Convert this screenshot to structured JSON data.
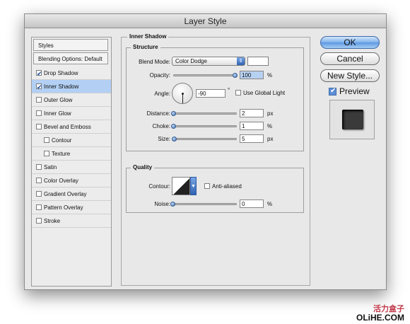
{
  "window": {
    "title": "Layer Style"
  },
  "sidebar": {
    "items": [
      {
        "label": "Styles",
        "kind": "head"
      },
      {
        "label": "Blending Options: Default",
        "kind": "plain"
      },
      {
        "label": "Drop Shadow",
        "kind": "check",
        "checked": true
      },
      {
        "label": "Inner Shadow",
        "kind": "check",
        "checked": true,
        "selected": true
      },
      {
        "label": "Outer Glow",
        "kind": "check",
        "checked": false
      },
      {
        "label": "Inner Glow",
        "kind": "check",
        "checked": false
      },
      {
        "label": "Bevel and Emboss",
        "kind": "check",
        "checked": false
      },
      {
        "label": "Contour",
        "kind": "check",
        "checked": false,
        "indent": true
      },
      {
        "label": "Texture",
        "kind": "check",
        "checked": false,
        "indent": true
      },
      {
        "label": "Satin",
        "kind": "check",
        "checked": false
      },
      {
        "label": "Color Overlay",
        "kind": "check",
        "checked": false
      },
      {
        "label": "Gradient Overlay",
        "kind": "check",
        "checked": false
      },
      {
        "label": "Pattern Overlay",
        "kind": "check",
        "checked": false
      },
      {
        "label": "Stroke",
        "kind": "check",
        "checked": false
      }
    ]
  },
  "panel": {
    "title": "Inner Shadow",
    "structure": {
      "title": "Structure",
      "blend_mode_label": "Blend Mode:",
      "blend_mode_value": "Color Dodge",
      "blend_color": "#ffffff",
      "opacity_label": "Opacity:",
      "opacity_value": "100",
      "opacity_unit": "%",
      "angle_label": "Angle:",
      "angle_value": "-90",
      "angle_unit": "°",
      "global_light_label": "Use Global Light",
      "global_light_checked": false,
      "distance_label": "Distance:",
      "distance_value": "2",
      "distance_unit": "px",
      "choke_label": "Choke:",
      "choke_value": "1",
      "choke_unit": "%",
      "size_label": "Size:",
      "size_value": "5",
      "size_unit": "px"
    },
    "quality": {
      "title": "Quality",
      "contour_label": "Contour:",
      "anti_aliased_label": "Anti-aliased",
      "anti_aliased_checked": false,
      "noise_label": "Noise:",
      "noise_value": "0",
      "noise_unit": "%"
    }
  },
  "actions": {
    "ok": "OK",
    "cancel": "Cancel",
    "new_style": "New Style...",
    "preview_label": "Preview",
    "preview_checked": true
  },
  "watermark": {
    "line1": "活力盒子",
    "line2": "OLiHE.COM"
  },
  "colors": {
    "accent": "#3a6fb4",
    "selection": "#b3d0f4",
    "dialog_bg": "#e8e8e8"
  }
}
